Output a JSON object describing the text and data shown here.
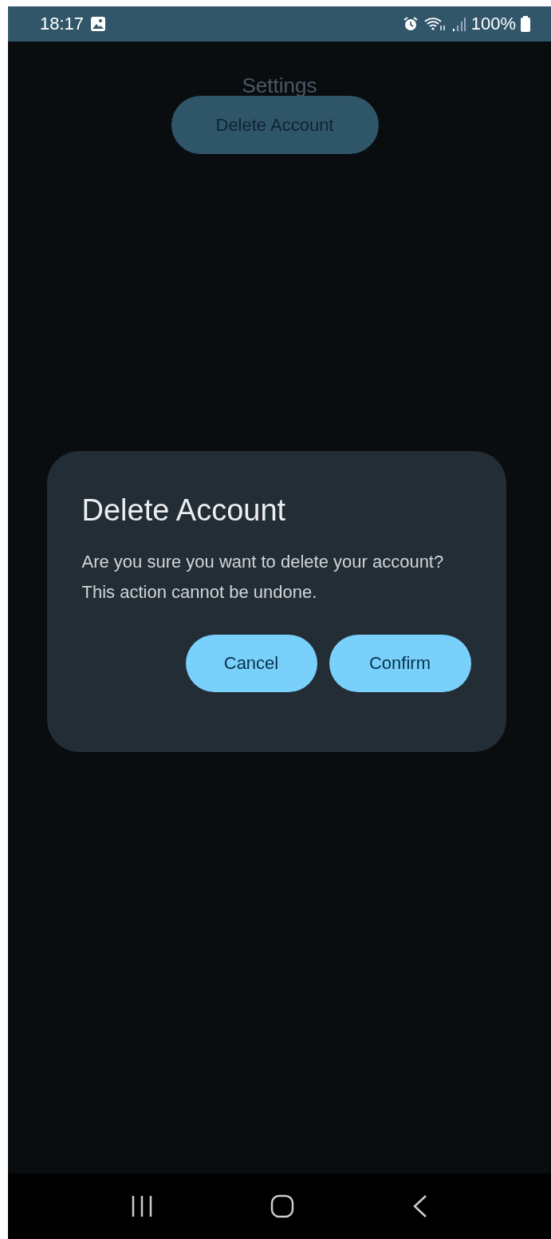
{
  "status_bar": {
    "time": "18:17",
    "battery": "100%"
  },
  "screen": {
    "title": "Settings",
    "button": "Delete Account"
  },
  "dialog": {
    "title": "Delete Account",
    "message": "Are you sure you want to delete your account? This action cannot be undone.",
    "buttons": [
      "Cancel",
      "Confirm"
    ]
  }
}
